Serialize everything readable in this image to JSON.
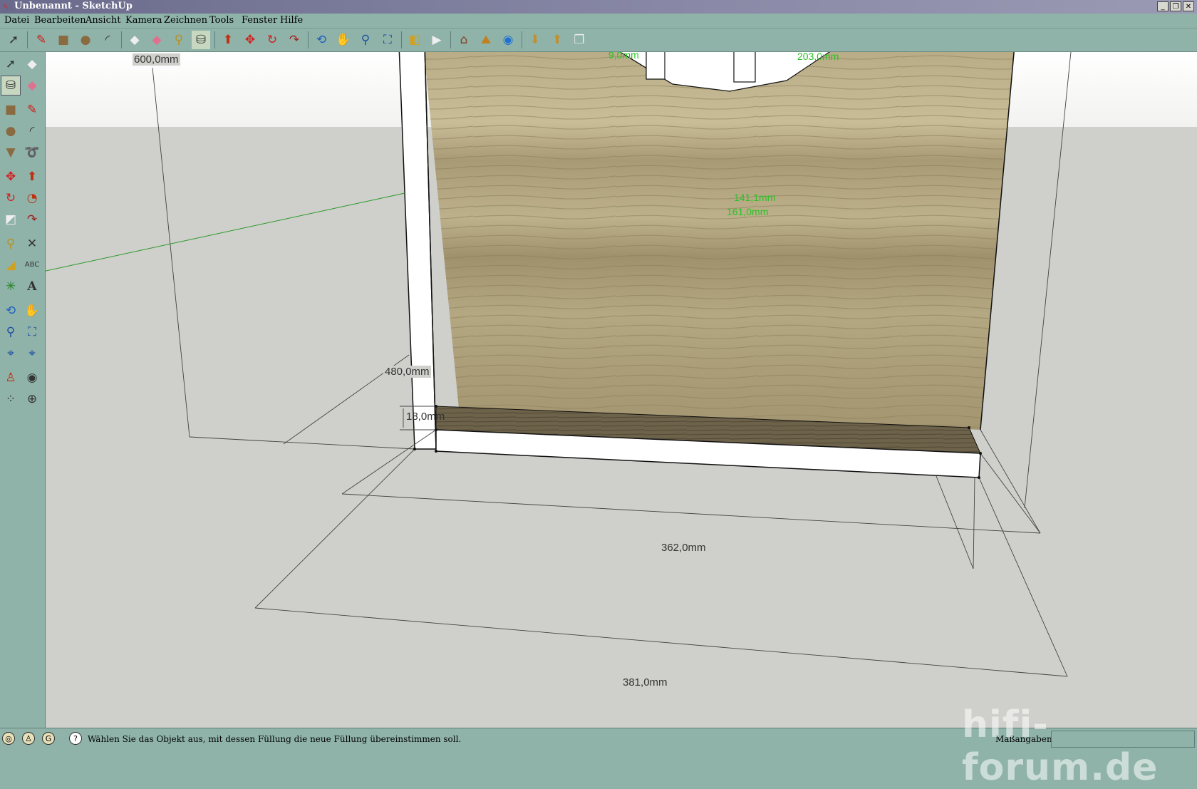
{
  "window": {
    "title": "Unbenannt - SketchUp",
    "buttons": [
      "_",
      "❐",
      "✕"
    ]
  },
  "menu": [
    "Datei",
    "Bearbeiten",
    "Ansicht",
    "Kamera",
    "Zeichnen",
    "Tools",
    "Fenster",
    "Hilfe"
  ],
  "toolbar_icons": [
    "select-icon",
    "pencil-icon",
    "rectangle-icon",
    "circle-icon",
    "arc-icon",
    "eraser-icon",
    "eraser-pink-icon",
    "tape-measure-icon",
    "paint-bucket-icon",
    "push-pull-icon",
    "move-icon",
    "rotate-icon",
    "follow-me-icon",
    "orbit-icon",
    "pan-icon",
    "zoom-icon",
    "zoom-extents-icon",
    "previous-view-icon",
    "next-view-icon",
    "add-location-icon",
    "toggle-terrain-icon",
    "google-earth-icon",
    "get-models-icon",
    "share-model-icon",
    "component-icon"
  ],
  "dimensions": {
    "height": "600,0mm",
    "depth": "480,0mm",
    "thickness": "18,0mm",
    "inner_width": "362,0mm",
    "outer_width": "381,0mm"
  },
  "green_labels": {
    "top_left": "9,0mm",
    "top_right": "203,0mm",
    "mid_1": "141,1mm",
    "mid_2": "161,0mm"
  },
  "status": {
    "text": "Wählen Sie das Objekt aus, mit dessen Füllung die neue Füllung übereinstimmen soll.",
    "measurements_label": "Maßangaben"
  },
  "watermark": "hifi-forum.de"
}
